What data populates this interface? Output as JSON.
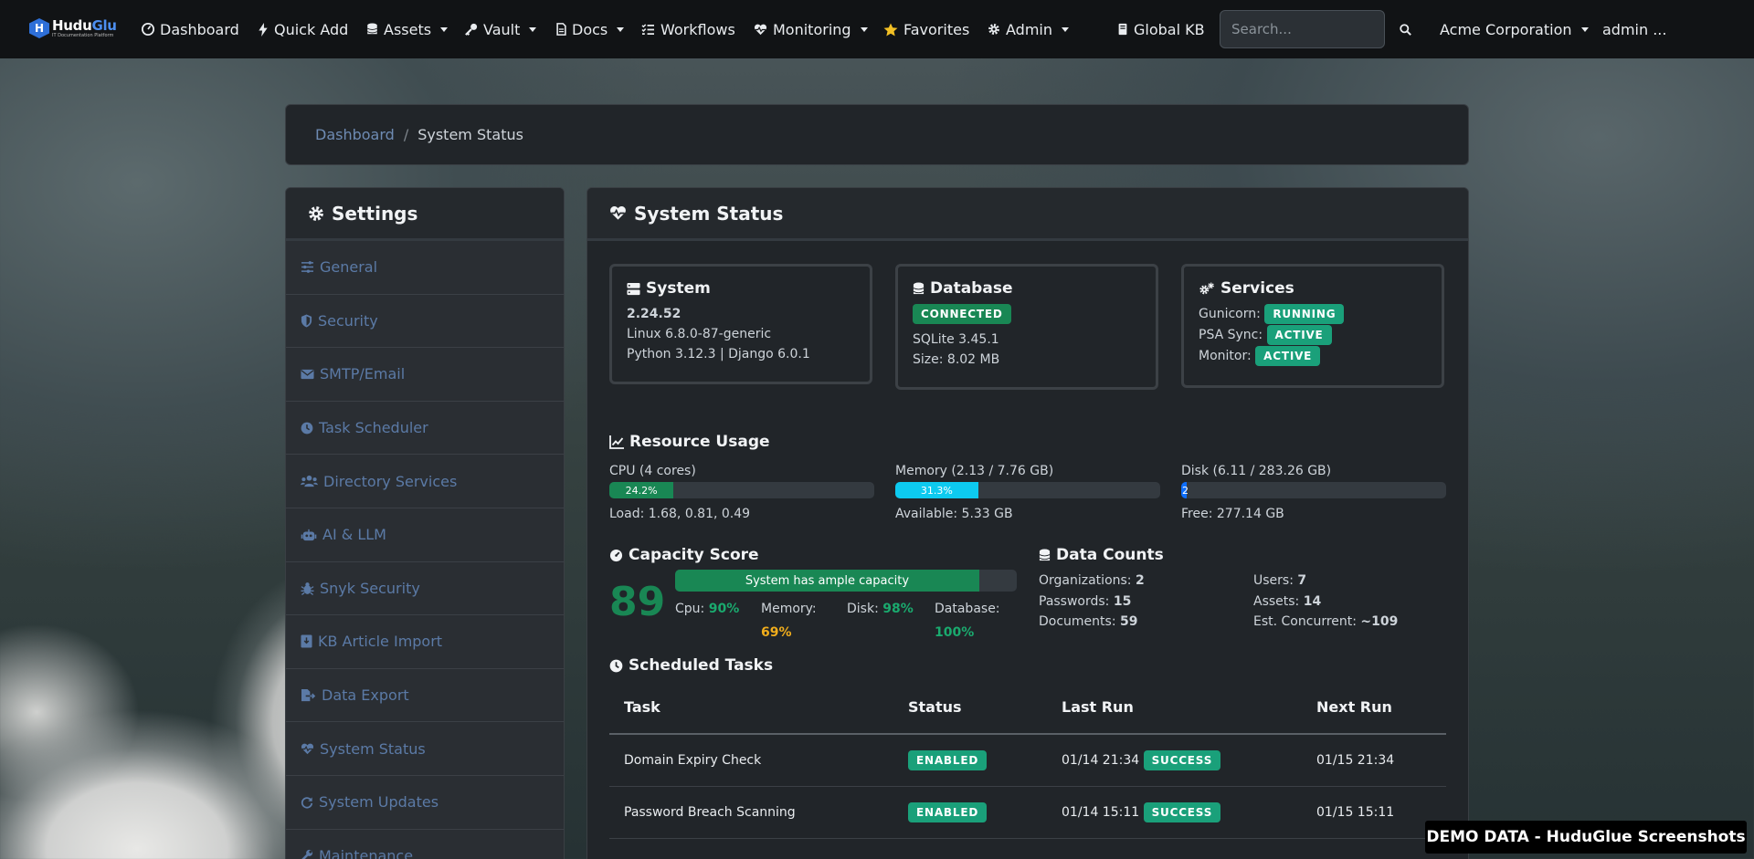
{
  "navbar": {
    "brand": {
      "name_prefix": "Hudu",
      "name_suffix": "Glue",
      "tagline": "IT Documentation Platform",
      "badge_letter": "H"
    },
    "items": [
      {
        "label": "Dashboard",
        "icon": "dashboard-icon",
        "dropdown": false
      },
      {
        "label": "Quick Add",
        "icon": "bolt-icon",
        "dropdown": false
      },
      {
        "label": "Assets",
        "icon": "database-icon",
        "dropdown": true
      },
      {
        "label": "Vault",
        "icon": "key-icon",
        "dropdown": true
      },
      {
        "label": "Docs",
        "icon": "document-icon",
        "dropdown": true
      },
      {
        "label": "Workflows",
        "icon": "list-check-icon",
        "dropdown": false
      },
      {
        "label": "Monitoring",
        "icon": "heart-pulse-icon",
        "dropdown": true
      },
      {
        "label": "Favorites",
        "icon": "star-icon",
        "dropdown": false
      },
      {
        "label": "Admin",
        "icon": "gear-icon",
        "dropdown": true
      },
      {
        "label": "Global KB",
        "icon": "book-icon",
        "dropdown": false
      }
    ],
    "search_placeholder": "Search...",
    "organization": "Acme Corporation",
    "user": "admin ..."
  },
  "breadcrumb": {
    "parent": "Dashboard",
    "separator": "/",
    "current": "System Status"
  },
  "settings": {
    "title": "Settings",
    "items": [
      {
        "label": "General",
        "icon": "sliders-icon"
      },
      {
        "label": "Security",
        "icon": "shield-icon"
      },
      {
        "label": "SMTP/Email",
        "icon": "envelope-icon"
      },
      {
        "label": "Task Scheduler",
        "icon": "clock-icon"
      },
      {
        "label": "Directory Services",
        "icon": "users-icon"
      },
      {
        "label": "AI & LLM",
        "icon": "robot-icon"
      },
      {
        "label": "Snyk Security",
        "icon": "bug-icon"
      },
      {
        "label": "KB Article Import",
        "icon": "book-import-icon"
      },
      {
        "label": "Data Export",
        "icon": "file-export-icon"
      },
      {
        "label": "System Status",
        "icon": "heart-pulse-icon"
      },
      {
        "label": "System Updates",
        "icon": "refresh-icon"
      },
      {
        "label": "Maintenance",
        "icon": "wrench-icon"
      }
    ]
  },
  "status": {
    "title": "System Status",
    "system": {
      "title": "System",
      "version": "2.24.52",
      "os": "Linux 6.8.0-87-generic",
      "runtime": "Python 3.12.3 | Django 6.0.1"
    },
    "database": {
      "title": "Database",
      "status": "CONNECTED",
      "engine": "SQLite 3.45.1",
      "size": "Size: 8.02 MB"
    },
    "services": {
      "title": "Services",
      "items": [
        {
          "label": "Gunicorn:",
          "status": "RUNNING"
        },
        {
          "label": "PSA Sync:",
          "status": "ACTIVE"
        },
        {
          "label": "Monitor:",
          "status": "ACTIVE"
        }
      ]
    },
    "resource_usage": {
      "title": "Resource Usage",
      "cpu": {
        "label": "CPU (4 cores)",
        "percent": 24.2,
        "percent_label": "24.2%",
        "sub": "Load: 1.68, 0.81, 0.49",
        "color": "#198754"
      },
      "memory": {
        "label": "Memory (2.13 / 7.76 GB)",
        "percent": 31.3,
        "percent_label": "31.3%",
        "sub": "Available: 5.33 GB",
        "color": "#0dcaf0"
      },
      "disk": {
        "label": "Disk (6.11 / 283.26 GB)",
        "percent": 2.2,
        "percent_label": "2",
        "sub": "Free: 277.14 GB",
        "color": "#0d6efd"
      }
    },
    "capacity": {
      "title": "Capacity Score",
      "score": "89",
      "fill_percent": 89,
      "message": "System has ample capacity",
      "metrics": {
        "cpu_label": "Cpu:",
        "cpu_value": "90%",
        "memory_label": "Memory:",
        "memory_value": "69%",
        "disk_label": "Disk:",
        "disk_value": "98%",
        "database_label": "Database:",
        "database_value": "100%"
      }
    },
    "data_counts": {
      "title": "Data Counts",
      "organizations_label": "Organizations:",
      "organizations": "2",
      "passwords_label": "Passwords:",
      "passwords": "15",
      "documents_label": "Documents:",
      "documents": "59",
      "users_label": "Users:",
      "users": "7",
      "assets_label": "Assets:",
      "assets": "14",
      "concurrent_label": "Est. Concurrent:",
      "concurrent": "~109"
    },
    "scheduled_tasks": {
      "title": "Scheduled Tasks",
      "columns": [
        "Task",
        "Status",
        "Last Run",
        "Next Run"
      ],
      "rows": [
        {
          "task": "Domain Expiry Check",
          "status": "ENABLED",
          "last_run": "01/14 21:34",
          "result": "SUCCESS",
          "next_run": "01/15 21:34"
        },
        {
          "task": "Password Breach Scanning",
          "status": "ENABLED",
          "last_run": "01/14 15:11",
          "result": "SUCCESS",
          "next_run": "01/15 15:11"
        }
      ]
    }
  },
  "demo_banner": "DEMO DATA - HuduGlue Screenshots",
  "colors": {
    "accent": "#198754",
    "link": "#5b7aa6",
    "navbar": "#111315",
    "card": "#212529"
  }
}
